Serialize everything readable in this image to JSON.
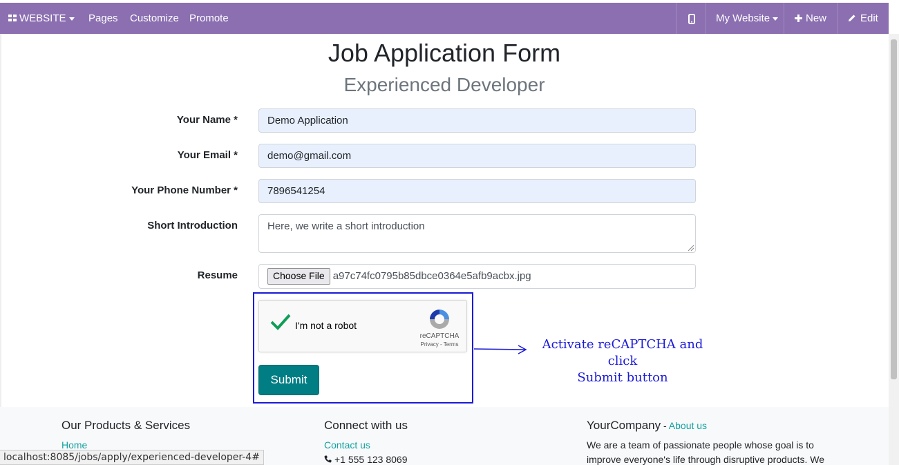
{
  "topbar": {
    "website_label": "WEBSITE",
    "pages_label": "Pages",
    "customize_label": "Customize",
    "promote_label": "Promote",
    "my_website_label": "My Website",
    "new_label": "New",
    "edit_label": "Edit"
  },
  "page": {
    "title": "Job Application Form",
    "subtitle": "Experienced Developer"
  },
  "form": {
    "name_label": "Your Name *",
    "name_value": "Demo Application",
    "email_label": "Your Email *",
    "email_value": "demo@gmail.com",
    "phone_label": "Your Phone Number *",
    "phone_value": "7896541254",
    "intro_label": "Short Introduction",
    "intro_value": "Here, we write a short introduction",
    "resume_label": "Resume",
    "choose_file_label": "Choose File",
    "file_name": "a97c74fc0795b85dbce0364e5afb9acbx.jpg",
    "submit_label": "Submit"
  },
  "recaptcha": {
    "label": "I'm not a robot",
    "brand": "reCAPTCHA",
    "terms": "Privacy - Terms",
    "checked": true
  },
  "annotation": {
    "line1": "Activate reCAPTCHA and click",
    "line2": "Submit button"
  },
  "footer": {
    "products_heading": "Our Products & Services",
    "home_link": "Home",
    "connect_heading": "Connect with us",
    "contact_link": "Contact us",
    "phone": "+1 555 123 8069",
    "company_name": "YourCompany",
    "company_sep": " - ",
    "about_link": "About us",
    "about_line1": "We are a team of passionate people whose goal is to",
    "about_line2": "improve everyone's life through disruptive products. We"
  },
  "status_bar": {
    "url": "localhost:8085/jobs/apply/experienced-developer-4#"
  },
  "colors": {
    "topbar": "#8b6fb1",
    "submit": "#017e84",
    "link": "#13a2a2",
    "annotation": "#1a1ad6",
    "autofill": "#e8f0fe"
  }
}
